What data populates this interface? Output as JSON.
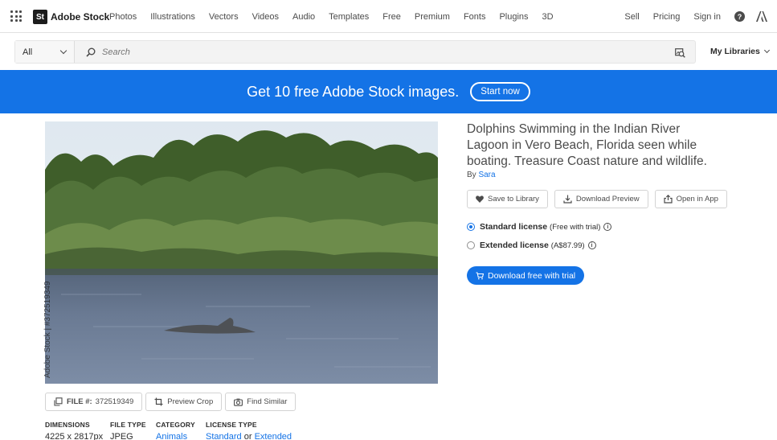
{
  "nav": {
    "logo_badge": "St",
    "logo_text": "Adobe Stock",
    "links": [
      "Photos",
      "Illustrations",
      "Vectors",
      "Videos",
      "Audio",
      "Templates",
      "Free",
      "Premium",
      "Fonts",
      "Plugins",
      "3D"
    ],
    "right": {
      "sell": "Sell",
      "pricing": "Pricing",
      "signin": "Sign in"
    },
    "help_glyph": "?"
  },
  "search": {
    "filter": "All",
    "placeholder": "Search",
    "my_libraries": "My Libraries"
  },
  "banner": {
    "text": "Get 10 free Adobe Stock images.",
    "button": "Start now",
    "color": "#1473e6"
  },
  "asset": {
    "watermark": "Adobe Stock | #372519349",
    "title": "Dolphins Swimming in the Indian River Lagoon in Vero Beach, Florida seen while boating. Treasure Coast nature and wildlife.",
    "by_prefix": "By",
    "author": "Sara",
    "actions": {
      "save": "Save to Library",
      "download_preview": "Download Preview",
      "open_app": "Open in App"
    },
    "licenses": {
      "standard": {
        "name": "Standard license",
        "note": "(Free with trial)",
        "selected": true
      },
      "extended": {
        "name": "Extended license",
        "note": "(A$87.99)",
        "selected": false
      }
    },
    "download_button": "Download free with trial",
    "tools": {
      "file_label": "FILE #:",
      "file_number": "372519349",
      "preview_crop": "Preview Crop",
      "find_similar": "Find Similar"
    },
    "meta": {
      "dimensions": {
        "label": "DIMENSIONS",
        "value": "4225 x 2817px"
      },
      "file_type": {
        "label": "FILE TYPE",
        "value": "JPEG"
      },
      "category": {
        "label": "CATEGORY",
        "value": "Animals"
      },
      "license_type": {
        "label": "LICENSE TYPE",
        "standard": "Standard",
        "or": "or",
        "extended": "Extended"
      }
    }
  }
}
